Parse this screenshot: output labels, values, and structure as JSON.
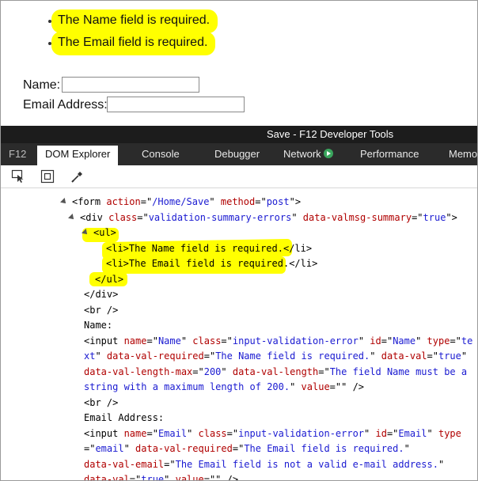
{
  "page": {
    "errors": [
      "The Name field is required.",
      "The Email field is required."
    ],
    "name_label": "Name:",
    "email_label": "Email Address:"
  },
  "devtools": {
    "title": "Save - F12 Developer Tools",
    "f12_label": "F12",
    "tabs": [
      "DOM Explorer",
      "Console",
      "Debugger",
      "Network",
      "Performance",
      "Memo"
    ],
    "toolbar_icons": [
      "select-element-icon",
      "highlight-box-icon",
      "color-picker-icon"
    ]
  },
  "dom_lines": [
    {
      "parts": [
        [
          "tg",
          "<form "
        ],
        [
          "an",
          "action"
        ],
        [
          "tg",
          "=\""
        ],
        [
          "av",
          "/Home/Save"
        ],
        [
          "tg",
          "\" "
        ],
        [
          "an",
          "method"
        ],
        [
          "tg",
          "=\""
        ],
        [
          "av",
          "post"
        ],
        [
          "tg",
          "\">"
        ]
      ]
    },
    {
      "parts": [
        [
          "tg",
          "<div "
        ],
        [
          "an",
          "class"
        ],
        [
          "tg",
          "=\""
        ],
        [
          "av",
          "validation-summary-errors"
        ],
        [
          "tg",
          "\" "
        ],
        [
          "an",
          "data-valmsg-summary"
        ],
        [
          "tg",
          "=\""
        ],
        [
          "av",
          "true"
        ],
        [
          "tg",
          "\">"
        ]
      ]
    },
    {
      "parts": [
        [
          "tg",
          "<ul>"
        ]
      ]
    },
    {
      "parts": [
        [
          "tg",
          "<li>"
        ],
        [
          "tx",
          "The Name field is required."
        ],
        [
          "tg",
          "</li>"
        ]
      ]
    },
    {
      "parts": [
        [
          "tg",
          "<li>"
        ],
        [
          "tx",
          "The Email field is required."
        ],
        [
          "tg",
          "</li>"
        ]
      ]
    },
    {
      "parts": [
        [
          "tg",
          "</ul>"
        ]
      ]
    },
    {
      "parts": [
        [
          "tg",
          "</div>"
        ]
      ]
    },
    {
      "parts": [
        [
          "tg",
          "<br />"
        ]
      ]
    },
    {
      "parts": [
        [
          "tx",
          "Name:"
        ]
      ]
    },
    {
      "parts": [
        [
          "tg",
          "<input "
        ],
        [
          "an",
          "name"
        ],
        [
          "tg",
          "=\""
        ],
        [
          "av",
          "Name"
        ],
        [
          "tg",
          "\" "
        ],
        [
          "an",
          "class"
        ],
        [
          "tg",
          "=\""
        ],
        [
          "av",
          "input-validation-error"
        ],
        [
          "tg",
          "\" "
        ],
        [
          "an",
          "id"
        ],
        [
          "tg",
          "=\""
        ],
        [
          "av",
          "Name"
        ],
        [
          "tg",
          "\" "
        ],
        [
          "an",
          "type"
        ],
        [
          "tg",
          "=\""
        ],
        [
          "av",
          "te"
        ]
      ]
    },
    {
      "parts": [
        [
          "av",
          "xt"
        ],
        [
          "tg",
          "\" "
        ],
        [
          "an",
          "data-val-required"
        ],
        [
          "tg",
          "=\""
        ],
        [
          "av",
          "The Name field is required."
        ],
        [
          "tg",
          "\" "
        ],
        [
          "an",
          "data-val"
        ],
        [
          "tg",
          "=\""
        ],
        [
          "av",
          "true"
        ],
        [
          "tg",
          "\""
        ]
      ]
    },
    {
      "parts": [
        [
          "an",
          "data-val-length-max"
        ],
        [
          "tg",
          "=\""
        ],
        [
          "av",
          "200"
        ],
        [
          "tg",
          "\" "
        ],
        [
          "an",
          "data-val-length"
        ],
        [
          "tg",
          "=\""
        ],
        [
          "av",
          "The field Name must be a"
        ]
      ]
    },
    {
      "parts": [
        [
          "av",
          "string with a maximum length of 200."
        ],
        [
          "tg",
          "\" "
        ],
        [
          "an",
          "value"
        ],
        [
          "tg",
          "=\"\" />"
        ]
      ]
    },
    {
      "parts": [
        [
          "tg",
          "<br />"
        ]
      ]
    },
    {
      "parts": [
        [
          "tx",
          "Email Address:"
        ]
      ]
    },
    {
      "parts": [
        [
          "tg",
          "<input "
        ],
        [
          "an",
          "name"
        ],
        [
          "tg",
          "=\""
        ],
        [
          "av",
          "Email"
        ],
        [
          "tg",
          "\" "
        ],
        [
          "an",
          "class"
        ],
        [
          "tg",
          "=\""
        ],
        [
          "av",
          "input-validation-error"
        ],
        [
          "tg",
          "\" "
        ],
        [
          "an",
          "id"
        ],
        [
          "tg",
          "=\""
        ],
        [
          "av",
          "Email"
        ],
        [
          "tg",
          "\" "
        ],
        [
          "an",
          "type"
        ]
      ]
    },
    {
      "parts": [
        [
          "tg",
          "=\""
        ],
        [
          "av",
          "email"
        ],
        [
          "tg",
          "\" "
        ],
        [
          "an",
          "data-val-required"
        ],
        [
          "tg",
          "=\""
        ],
        [
          "av",
          "The Email field is required."
        ],
        [
          "tg",
          "\""
        ]
      ]
    },
    {
      "parts": [
        [
          "an",
          "data-val-email"
        ],
        [
          "tg",
          "=\""
        ],
        [
          "av",
          "The Email field is not a valid e-mail address."
        ],
        [
          "tg",
          "\""
        ]
      ]
    },
    {
      "parts": [
        [
          "an",
          "data-val"
        ],
        [
          "tg",
          "=\""
        ],
        [
          "av",
          "true"
        ],
        [
          "tg",
          "\" "
        ],
        [
          "an",
          "value"
        ],
        [
          "tg",
          "=\"\" />"
        ]
      ]
    }
  ]
}
